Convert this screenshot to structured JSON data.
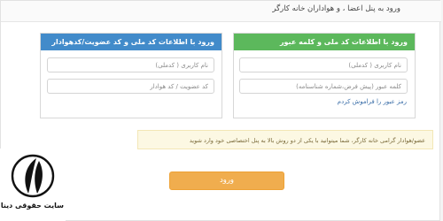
{
  "header": {
    "title": "ورود به پنل اعضا ، و هواداران خانه کارگر"
  },
  "panel_national": {
    "title": "ورود با اطلاعات کد ملی و کلمه عبور",
    "username_placeholder": "نام کاربری ( کدملی)",
    "password_placeholder": "کلمه عبور (پیش فرض،شماره شناسنامه)",
    "forgot_link": "رمز عبور را فراموش کردم"
  },
  "panel_member": {
    "title": "ورود با اطلاعات کد ملی و کد عضویت/کدهوادار",
    "username_placeholder": "نام کاربری ( کدملی)",
    "code_placeholder": "کد عضویت / کد هوادار"
  },
  "notice": {
    "text": "عضو/هوادار گرامی خانه کارگر، شما میتوانید با یکی از دو روش بالا به پنل اختصاصی خود وارد شوید"
  },
  "submit_label": "ورود",
  "watermark": {
    "text": "سایت حقوقی دینا"
  },
  "colors": {
    "green_header": "#5cb85c",
    "blue_header": "#428bca",
    "submit": "#f0ad4e",
    "notice_bg": "#fcf8e3"
  }
}
